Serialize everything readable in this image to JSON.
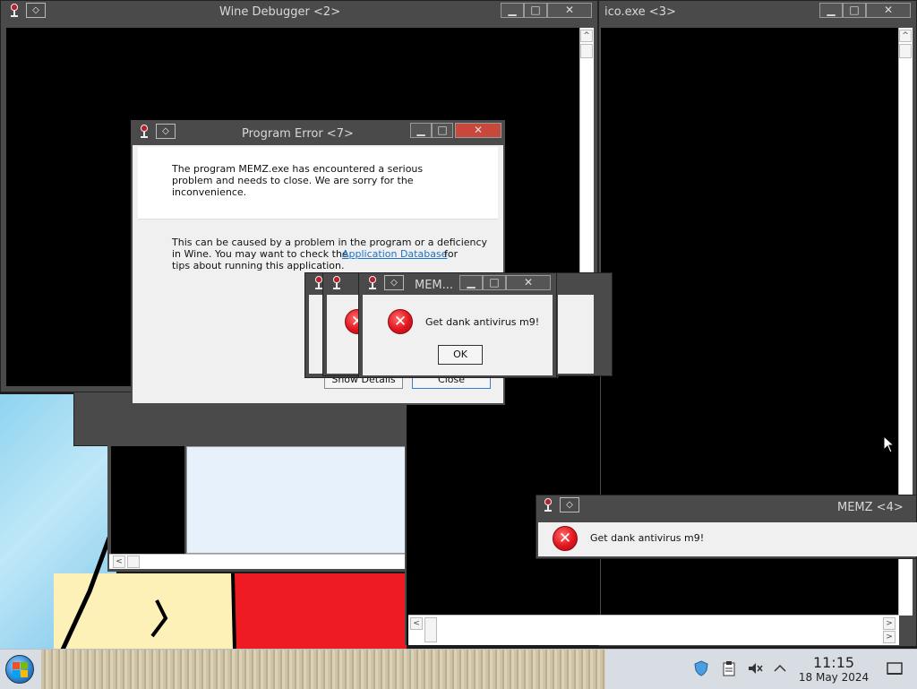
{
  "windows": {
    "wine_debugger": {
      "title": "Wine Debugger <2>"
    },
    "ico_exe": {
      "title": "ico.exe <3>"
    },
    "program_error": {
      "title": "Program Error <7>",
      "message_main": "The program MEMZ.exe has encountered a serious problem and needs to close. We are sorry for the inconvenience.",
      "message_detail_1": "This can be caused by a problem in the program or a deficiency",
      "message_detail_2": "in Wine. You may want to check the",
      "link_text": "Application Database",
      "message_detail_3": "for",
      "message_detail_4": "tips about running this application.",
      "show_details_label": "Show Details",
      "close_label": "Close"
    },
    "memz_small": {
      "title": "MEM...",
      "message": "Get dank antivirus m9!",
      "ok_label": "OK"
    },
    "memz_4": {
      "title": "MEMZ <4>",
      "message": "Get dank antivirus m9!"
    }
  },
  "titlebar_buttons": {
    "minimize": "▁",
    "maximize": "□",
    "close": "✕",
    "sysmenu": "◇"
  },
  "scroll_arrows": {
    "up": "^",
    "down": "v",
    "left": "<",
    "right": ">"
  },
  "taskbar": {
    "time": "11:15",
    "date": "18 May 2024",
    "tray_icons": [
      "shield-icon",
      "clipboard-icon",
      "speaker-muted-icon",
      "chevron-up-icon",
      "show-desktop-icon"
    ]
  },
  "colors": {
    "title_bar": "#4a4a4a",
    "dialog_bg": "#f0f0f0",
    "error_red": "#e0161e",
    "link_blue": "#1a73c8",
    "taskbar": "#d8dde4"
  }
}
